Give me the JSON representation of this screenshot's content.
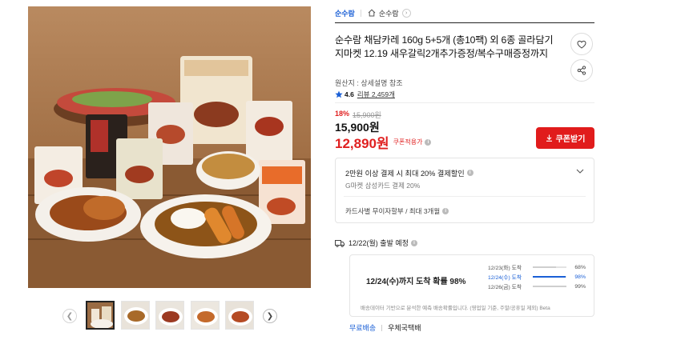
{
  "store": {
    "name": "순수람",
    "home_label": "순수람"
  },
  "product": {
    "title": "순수람 채담카레 160g 5+5개 (총10팩) 외 6종 골라담기 지마켓 12.19 새우갈릭2개추가증정/복수구매증정까지",
    "origin": "원산지 : 상세설명 참조",
    "rating": "4.6",
    "review_text": "리뷰 2,459개"
  },
  "price": {
    "discount_rate": "18%",
    "original": "15,900원",
    "sale": "15,900원",
    "coupon_price": "12,890원",
    "coupon_label": "쿠폰적용가",
    "coupon_button": "쿠폰받기"
  },
  "card_promo": {
    "title": "2만원 이상 결제 시 최대 20% 결제할인",
    "subtitle": "G마켓 삼성카드 결제 20%",
    "installment": "카드사별 무이자할부 / 최대 3개월"
  },
  "shipping": {
    "departure": "12/22(월) 출발 예정",
    "probability_text": "12/24(수)까지 도착 확률 98%",
    "rows": [
      {
        "date": "12/23(화) 도착",
        "percent": "68%",
        "value": 0.68,
        "highlight": false
      },
      {
        "date": "12/24(수) 도착",
        "percent": "98%",
        "value": 0.98,
        "highlight": true
      },
      {
        "date": "12/26(금) 도착",
        "percent": "99%",
        "value": 0.99,
        "highlight": false
      }
    ],
    "note": "배송데이터 기반으로 분석한 예측 배송확률입니다. (영업일 기준, 주말/공휴일 제외) Beta",
    "free_label": "무료배송",
    "carrier": "우체국택배"
  },
  "colors": {
    "accent_red": "#e11c1c",
    "link_blue": "#1a5fd6",
    "star_blue": "#1a5fd6"
  },
  "icons": [
    "home-icon",
    "heart-icon",
    "share-icon",
    "star-icon",
    "download-icon",
    "chevron-down-icon",
    "truck-icon",
    "info-icon",
    "chevron-left-icon",
    "chevron-right-icon"
  ]
}
